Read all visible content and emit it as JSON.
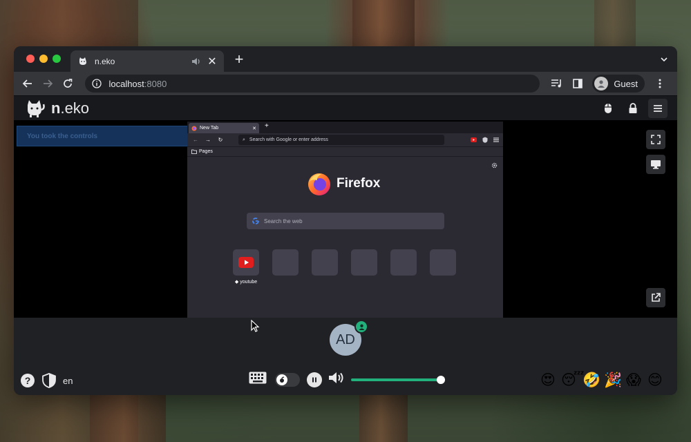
{
  "browser": {
    "tab_title": "n.eko",
    "url_host": "localhost",
    "url_port": ":8080",
    "profile_name": "Guest"
  },
  "neko": {
    "logo_bold": "n",
    "logo_rest": ".eko",
    "banner_text": "You took the controls",
    "member_initials": "AD",
    "language": "en",
    "volume_level": 0.97,
    "emojis": [
      "😍",
      "😴",
      "🤣",
      "🎉",
      "😱",
      "😊"
    ]
  },
  "remote_firefox": {
    "tab_title": "New Tab",
    "address_placeholder": "Search with Google or enter address",
    "bookmark_folder": "Pages",
    "brand": "Firefox",
    "search_placeholder": "Search the web",
    "tiles": [
      {
        "label": "youtube",
        "icon": "youtube-icon"
      },
      {
        "label": "",
        "icon": ""
      },
      {
        "label": "",
        "icon": ""
      },
      {
        "label": "",
        "icon": ""
      },
      {
        "label": "",
        "icon": ""
      },
      {
        "label": "",
        "icon": ""
      }
    ]
  },
  "colors": {
    "accent": "#22b07d",
    "chrome_bg": "#202124",
    "toolbar_bg": "#35363a"
  }
}
